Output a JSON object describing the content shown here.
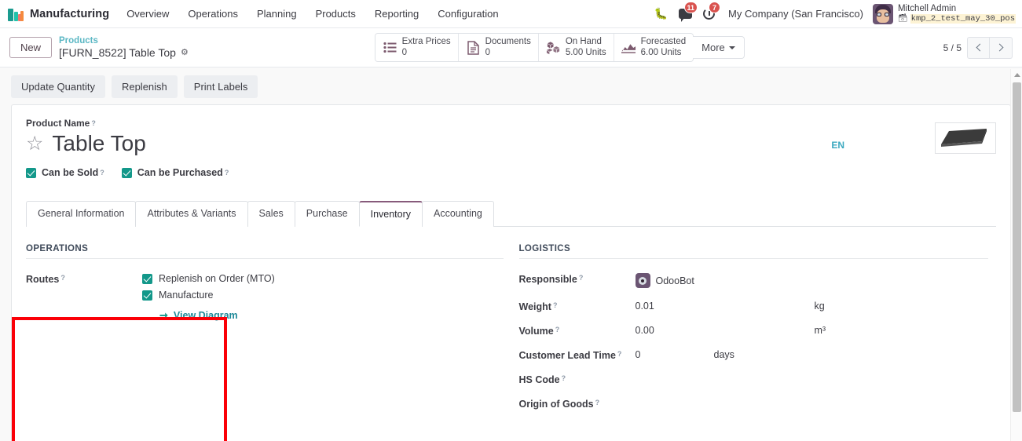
{
  "navbar": {
    "app_name": "Manufacturing",
    "app_logo_icon": "manufacturing-app-icon",
    "menu_items": [
      "Overview",
      "Operations",
      "Planning",
      "Products",
      "Reporting",
      "Configuration"
    ],
    "bug_icon": "bug-icon",
    "messages_icon": "chat-bubble-icon",
    "messages_count": "11",
    "activities_icon": "clock-icon",
    "activities_count": "7",
    "company": "My Company (San Francisco)",
    "user_name": "Mitchell Admin",
    "user_db": "kmp_2_test_may_30_pos",
    "db_icon": "database-icon",
    "avatar_icon": "user-avatar"
  },
  "control_panel": {
    "new_label": "New",
    "breadcrumb_parent": "Products",
    "breadcrumb_current": "[FURN_8522] Table Top",
    "gear_icon": "gear-icon",
    "stat_buttons": [
      {
        "icon": "list-icon",
        "label": "Extra Prices",
        "value": "0"
      },
      {
        "icon": "document-icon",
        "label": "Documents",
        "value": "0"
      },
      {
        "icon": "boxes-icon",
        "label": "On Hand",
        "value": "5.00 Units"
      },
      {
        "icon": "area-chart-icon",
        "label": "Forecasted",
        "value": "6.00 Units"
      }
    ],
    "more_label": "More",
    "more_caret_icon": "caret-down-icon",
    "pager_text": "5 / 5",
    "prev_icon": "chevron-left-icon",
    "next_icon": "chevron-right-icon"
  },
  "action_bar": {
    "buttons": [
      "Update Quantity",
      "Replenish",
      "Print Labels"
    ]
  },
  "form": {
    "product_name_label": "Product Name",
    "product_name": "Table Top",
    "star_icon": "star-favorite-icon",
    "language_badge": "EN",
    "product_image_icon": "table-top-product-image",
    "checkboxes": [
      {
        "label": "Can be Sold",
        "checked": true
      },
      {
        "label": "Can be Purchased",
        "checked": true
      }
    ],
    "tabs": [
      {
        "label": "General Information",
        "active": false
      },
      {
        "label": "Attributes & Variants",
        "active": false
      },
      {
        "label": "Sales",
        "active": false
      },
      {
        "label": "Purchase",
        "active": false
      },
      {
        "label": "Inventory",
        "active": true
      },
      {
        "label": "Accounting",
        "active": false
      }
    ],
    "operations": {
      "title": "OPERATIONS",
      "routes_label": "Routes",
      "routes": [
        {
          "label": "Replenish on Order (MTO)",
          "checked": true
        },
        {
          "label": "Manufacture",
          "checked": true
        }
      ],
      "view_diagram_label": "View Diagram",
      "view_diagram_icon": "arrow-right-icon"
    },
    "logistics": {
      "title": "LOGISTICS",
      "responsible_label": "Responsible",
      "responsible_value": "OdooBot",
      "responsible_avatar_icon": "odoobot-avatar-icon",
      "weight_label": "Weight",
      "weight_value": "0.01",
      "weight_unit": "kg",
      "volume_label": "Volume",
      "volume_value": "0.00",
      "volume_unit": "m³",
      "lead_time_label": "Customer Lead Time",
      "lead_time_value": "0",
      "lead_time_unit": "days",
      "hs_code_label": "HS Code",
      "hs_code_value": "",
      "origin_label": "Origin of Goods",
      "origin_value": ""
    }
  },
  "annotation": {
    "highlight_color": "#fb0007",
    "target": "operations-group"
  },
  "scrollbar": {
    "up_arrow_icon": "scroll-up-arrow-icon"
  }
}
